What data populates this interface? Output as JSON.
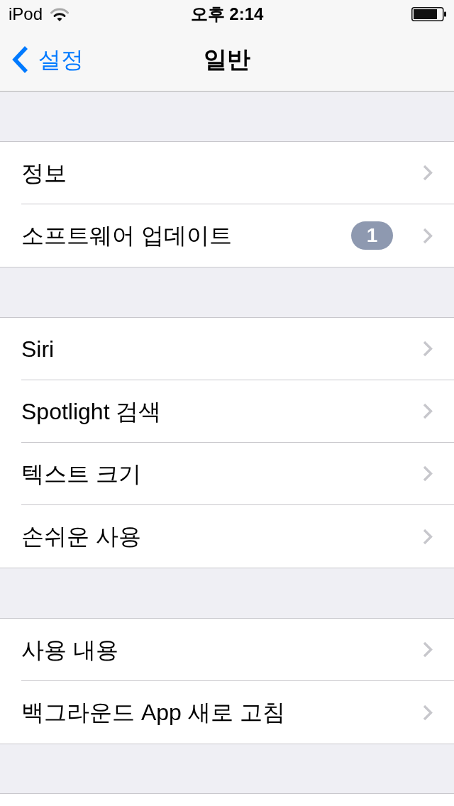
{
  "status_bar": {
    "device": "iPod",
    "time": "오후 2:14"
  },
  "nav_bar": {
    "back": "설정",
    "title": "일반"
  },
  "sections": [
    {
      "rows": [
        {
          "label": "정보"
        },
        {
          "label": "소프트웨어 업데이트",
          "badge": "1"
        }
      ]
    },
    {
      "rows": [
        {
          "label": "Siri"
        },
        {
          "label": "Spotlight 검색"
        },
        {
          "label": "텍스트 크기"
        },
        {
          "label": "손쉬운 사용"
        }
      ]
    },
    {
      "rows": [
        {
          "label": "사용 내용"
        },
        {
          "label": "백그라운드 App 새로 고침"
        }
      ]
    }
  ]
}
